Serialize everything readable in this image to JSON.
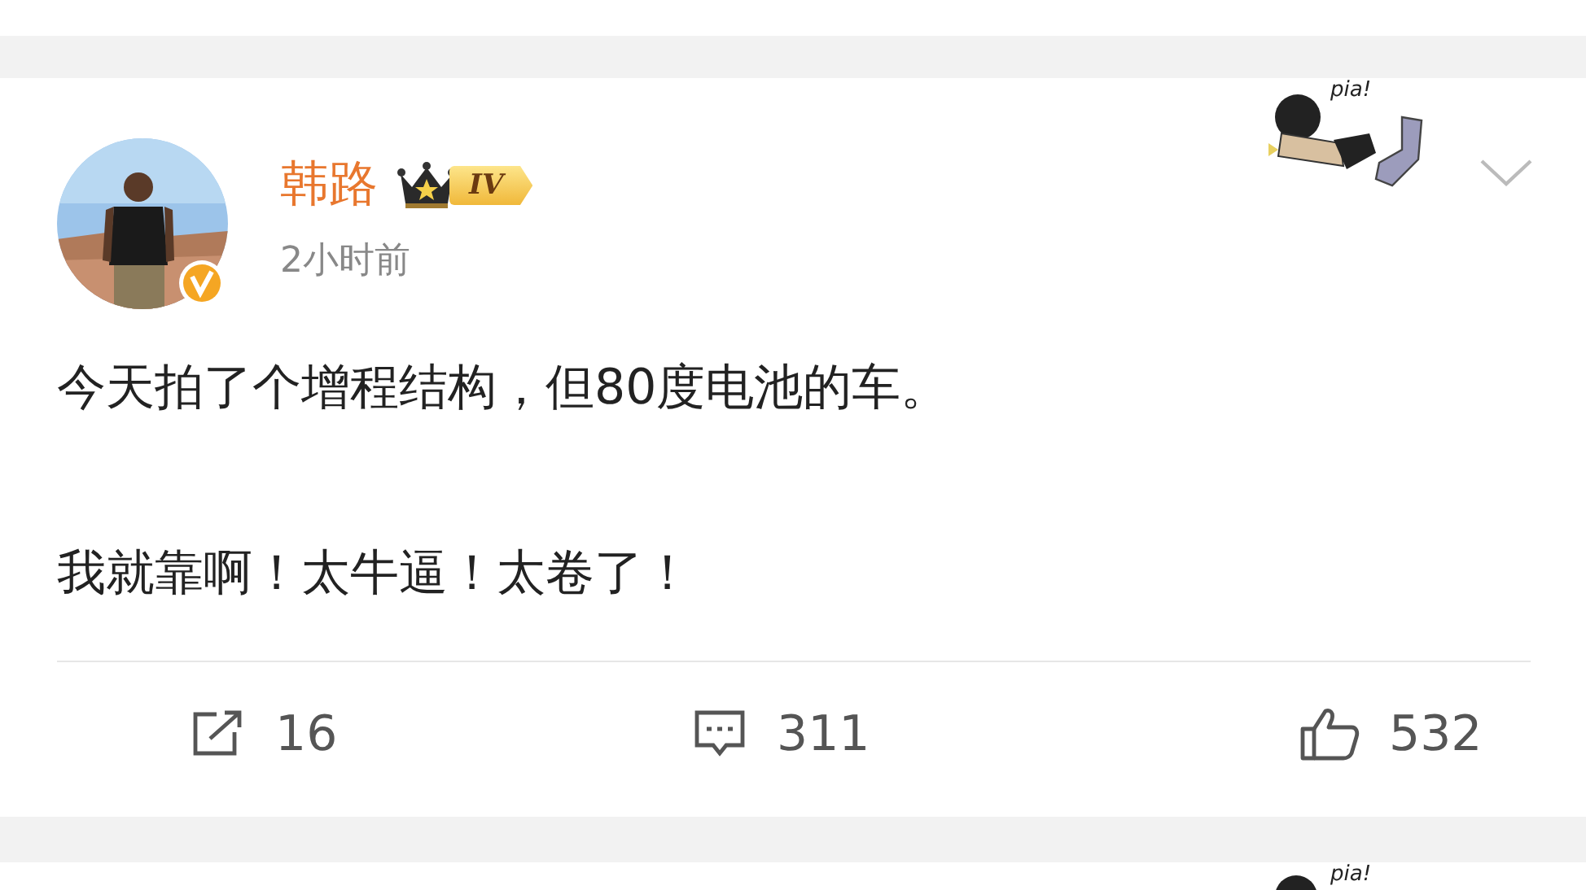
{
  "post": {
    "author": "韩路",
    "level_badge": "IV",
    "time": "2小时前",
    "sticker_text": "pia!",
    "paragraphs": [
      "今天拍了个增程结构，但80度电池的车。",
      "我就靠啊！太牛逼！太卷了！"
    ],
    "actions": [
      {
        "kind": "repost",
        "count": "16"
      },
      {
        "kind": "comment",
        "count": "311"
      },
      {
        "kind": "like",
        "count": "532"
      }
    ]
  },
  "next_post": {
    "sticker_text": "pia!"
  }
}
